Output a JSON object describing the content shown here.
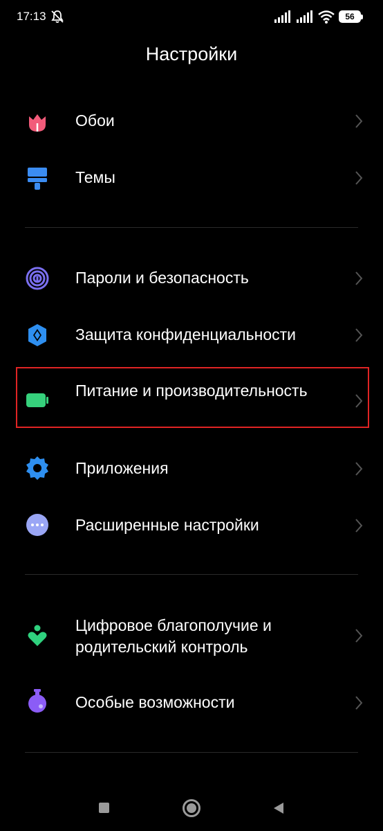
{
  "status_bar": {
    "time": "17:13",
    "battery": "56",
    "icons": [
      "mute-icon",
      "signal-icon",
      "signal-icon",
      "wifi-icon",
      "battery-icon"
    ]
  },
  "page": {
    "title": "Настройки"
  },
  "groups": [
    {
      "items": [
        {
          "label": "Обои",
          "icon": "wallpaper-icon",
          "color": "#f25b7a"
        },
        {
          "label": "Темы",
          "icon": "themes-icon",
          "color": "#3b8cf2"
        }
      ]
    },
    {
      "items": [
        {
          "label": "Пароли и безопасность",
          "icon": "fingerprint-icon",
          "color": "#7a6ff0"
        },
        {
          "label": "Защита конфиденциальности",
          "icon": "privacy-shield-icon",
          "color": "#2e8ff0"
        },
        {
          "label": "Питание и производительность",
          "icon": "battery-icon",
          "color": "#36d17c",
          "highlighted": true
        },
        {
          "label": "Приложения",
          "icon": "gear-icon",
          "color": "#2e8ff0"
        },
        {
          "label": "Расширенные настройки",
          "icon": "more-icon",
          "color": "#9aa6f5"
        }
      ]
    },
    {
      "items": [
        {
          "label": "Цифровое благополучие и родительский контроль",
          "icon": "wellbeing-icon",
          "color": "#2fd17e"
        },
        {
          "label": "Особые возможности",
          "icon": "accessibility-icon",
          "color": "#8b5cf6"
        }
      ]
    }
  ],
  "nav_bar": {
    "icons": [
      "recent-apps-icon",
      "home-icon",
      "back-icon"
    ]
  }
}
